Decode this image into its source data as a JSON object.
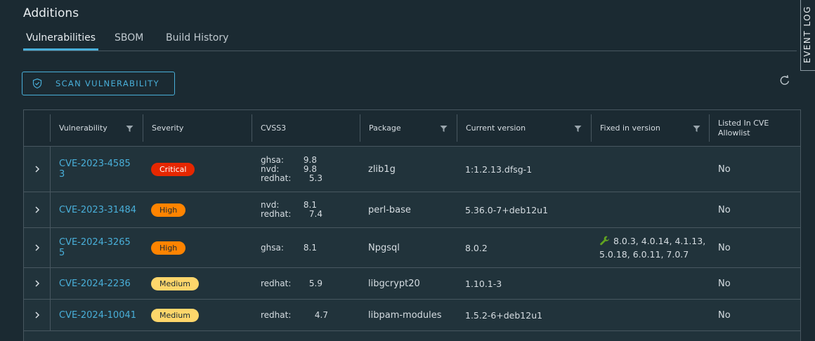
{
  "page": {
    "title": "Additions",
    "event_log_label": "EVENT LOG"
  },
  "tabs": [
    {
      "label": "Vulnerabilities",
      "active": true
    },
    {
      "label": "SBOM",
      "active": false
    },
    {
      "label": "Build History",
      "active": false
    }
  ],
  "toolbar": {
    "scan_label": "SCAN VULNERABILITY",
    "scan_icon": "shield-check-icon",
    "refresh_icon": "refresh-icon"
  },
  "colors": {
    "accent": "#49afd9",
    "critical": "#e62700",
    "high": "#ff8400",
    "medium": "#fdd66b",
    "background": "#1b2a32"
  },
  "table": {
    "columns": [
      {
        "label": "Vulnerability",
        "filter": true
      },
      {
        "label": "Severity",
        "filter": false
      },
      {
        "label": "CVSS3",
        "filter": false
      },
      {
        "label": "Package",
        "filter": true
      },
      {
        "label": "Current version",
        "filter": true
      },
      {
        "label": "Fixed in version",
        "filter": true
      },
      {
        "label": "Listed In CVE Allowlist",
        "filter": false
      }
    ],
    "rows": [
      {
        "cve": "CVE-2023-45853",
        "cve_line1": "CVE-2023-4585",
        "cve_line2": "3",
        "severity": "Critical",
        "cvss": [
          {
            "src": "ghsa:",
            "val": "9.8"
          },
          {
            "src": "nvd:",
            "val": "9.8"
          },
          {
            "src": "redhat:",
            "val": "5.3"
          }
        ],
        "package": "zlib1g",
        "current": "1:1.2.13.dfsg-1",
        "fixed": "",
        "allowlist": "No"
      },
      {
        "cve": "CVE-2023-31484",
        "cve_line1": "CVE-2023-31484",
        "cve_line2": "",
        "severity": "High",
        "cvss": [
          {
            "src": "nvd:",
            "val": "8.1"
          },
          {
            "src": "redhat:",
            "val": "7.4"
          }
        ],
        "package": "perl-base",
        "current": "5.36.0-7+deb12u1",
        "fixed": "",
        "allowlist": "No"
      },
      {
        "cve": "CVE-2024-32655",
        "cve_line1": "CVE-2024-3265",
        "cve_line2": "5",
        "severity": "High",
        "cvss": [
          {
            "src": "ghsa:",
            "val": "8.1"
          }
        ],
        "package": "Npgsql",
        "current": "8.0.2",
        "fixed_line1": "8.0.3, 4.0.14, 4.1.13,",
        "fixed_line2": "5.0.18, 6.0.11, 7.0.7",
        "fixed_icon": "wrench-icon",
        "allowlist": "No"
      },
      {
        "cve": "CVE-2024-2236",
        "cve_line1": "CVE-2024-2236",
        "cve_line2": "",
        "severity": "Medium",
        "cvss": [
          {
            "src": "redhat:",
            "val": "5.9"
          }
        ],
        "package": "libgcrypt20",
        "current": "1.10.1-3",
        "fixed": "",
        "allowlist": "No"
      },
      {
        "cve": "CVE-2024-10041",
        "cve_line1": "CVE-2024-10041",
        "cve_line2": "",
        "severity": "Medium",
        "cvss": [
          {
            "src": "redhat:",
            "val": "4.7"
          }
        ],
        "package": "libpam-modules",
        "current": "1.5.2-6+deb12u1",
        "fixed": "",
        "allowlist": "No"
      }
    ]
  }
}
